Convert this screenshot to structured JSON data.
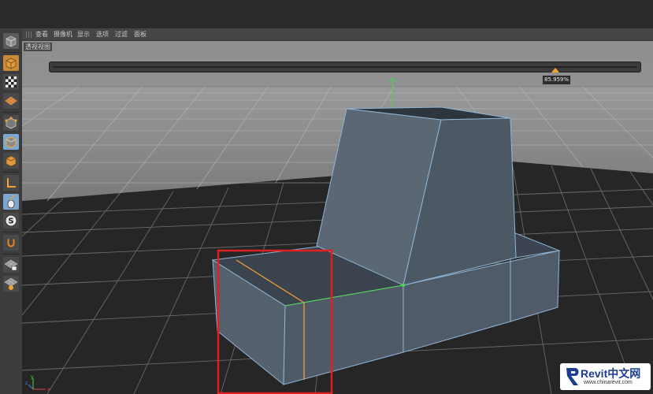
{
  "menu": {
    "items": [
      {
        "label": "查看"
      },
      {
        "label": "摄像机"
      },
      {
        "label": "显示"
      },
      {
        "label": "选项"
      },
      {
        "label": "过滤"
      },
      {
        "label": "面板"
      }
    ]
  },
  "viewport": {
    "label": "透视视图"
  },
  "slider": {
    "value": "85.959%",
    "fraction": 0.85959
  },
  "colors": {
    "selection_highlight": "#e02020",
    "edge_selected": "#f2a133",
    "edge_green": "#49d84a",
    "mesh_face": "#4e5966",
    "mesh_edge": "#8fb6d8"
  },
  "toolbar": {
    "icons": [
      {
        "name": "cube-view-icon"
      },
      {
        "name": "checker-texture-icon"
      },
      {
        "name": "texture-tag-icon"
      },
      {
        "name": "points-mode-icon"
      },
      {
        "name": "edges-mode-icon"
      },
      {
        "name": "polygons-mode-icon"
      },
      {
        "name": "axis-mode-icon"
      },
      {
        "name": "tweak-mode-icon"
      },
      {
        "name": "snap-icon"
      },
      {
        "name": "magnet-icon"
      },
      {
        "name": "workplane-lock-icon"
      },
      {
        "name": "workplane-icon"
      }
    ]
  },
  "logo": {
    "brand": "Revit中文网",
    "url": "www.chinarevit.com"
  }
}
